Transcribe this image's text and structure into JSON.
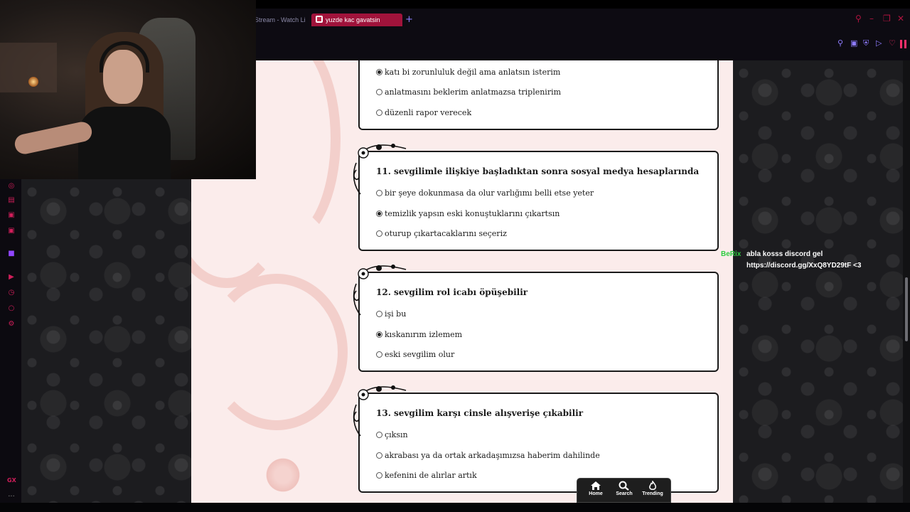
{
  "browser": {
    "tabs": [
      {
        "label": "Stream - Watch Li"
      },
      {
        "label": "yuzde kac gavatsin"
      }
    ],
    "new_tab_label": "+"
  },
  "quiz": {
    "q10_options": [
      {
        "label": "katı bi zorunluluk değil ama anlatsın isterim",
        "selected": true
      },
      {
        "label": "anlatmasını beklerim anlatmazsa triplenirim",
        "selected": false
      },
      {
        "label": "düzenli rapor verecek",
        "selected": false
      }
    ],
    "questions": [
      {
        "title": "11. sevgilimle ilişkiye başladıktan sonra sosyal medya hesaplarında",
        "options": [
          {
            "label": "bir şeye dokunmasa da olur varlığımı belli etse yeter",
            "selected": false
          },
          {
            "label": "temizlik yapsın eski konuştuklarını çıkartsın",
            "selected": true
          },
          {
            "label": "oturup çıkartacaklarını seçeriz",
            "selected": false
          }
        ]
      },
      {
        "title": "12. sevgilim rol icabı öpüşebilir",
        "options": [
          {
            "label": "işi bu",
            "selected": false
          },
          {
            "label": "kıskanırım izlemem",
            "selected": true
          },
          {
            "label": "eski sevgilim olur",
            "selected": false
          }
        ]
      },
      {
        "title": "13. sevgilim karşı cinsle alışverişe çıkabilir",
        "options": [
          {
            "label": "çıksın",
            "selected": false
          },
          {
            "label": "akrabası ya da ortak arkadaşımızsa haberim dahilinde",
            "selected": false
          },
          {
            "label": "kefenini de alırlar artık",
            "selected": false
          }
        ]
      }
    ]
  },
  "chat": {
    "username": "BeRix",
    "message": "abla kosss discord gel https://discord.gg/XxQ8YD29tF <3",
    "username_color": "#2ecc40"
  },
  "bottom_nav": {
    "home_label": "Home",
    "search_label": "Search",
    "trending_label": "Trending"
  },
  "left_rail": {
    "gx_label": "GX",
    "more_label": "..."
  },
  "colors": {
    "accent": "#a0133b",
    "page_bg": "#fbeceb",
    "twitch": "#9146ff"
  }
}
